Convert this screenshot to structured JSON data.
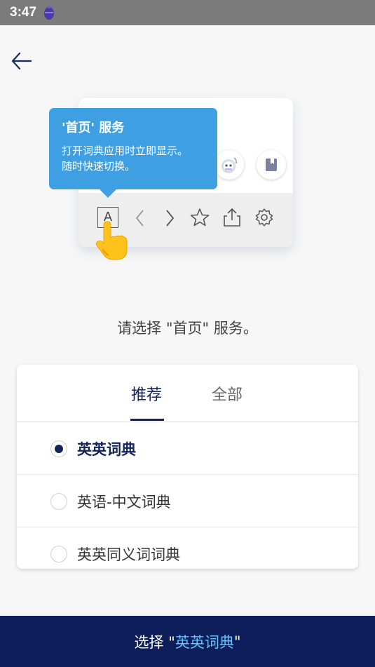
{
  "status_bar": {
    "time": "3:47"
  },
  "illustration": {
    "tooltip": {
      "title": "'首页' 服务",
      "line1": "打开词典应用时立即显示。",
      "line2": "随时快速切换。"
    },
    "toolbar_letter": "A"
  },
  "prompt": "请选择 \"首页\" 服务。",
  "tabs": {
    "recommended": "推荐",
    "all": "全部"
  },
  "options": [
    {
      "label": "英英词典",
      "selected": true
    },
    {
      "label": "英语-中文词典",
      "selected": false
    },
    {
      "label": "英英同义词词典",
      "selected": false
    }
  ],
  "bottom_button": {
    "prefix": "选择 \"",
    "highlight": "英英词典",
    "suffix": "\""
  },
  "colors": {
    "primary": "#0e1e5b",
    "tooltip": "#3e9fe2",
    "highlight": "#5fc3ff"
  }
}
